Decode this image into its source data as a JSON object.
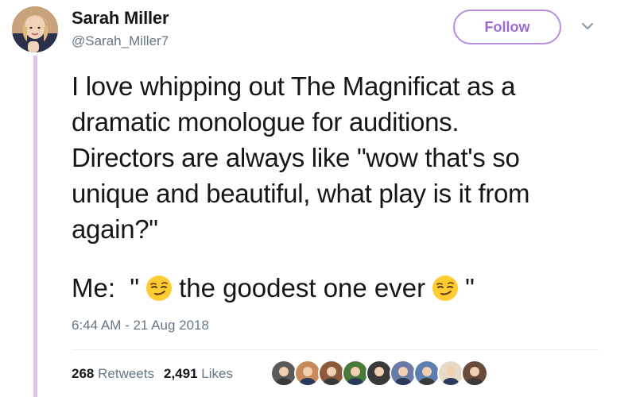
{
  "author": {
    "name": "Sarah Miller",
    "handle": "@Sarah_Miller7",
    "avatar_icon": "user-avatar-photo"
  },
  "follow": {
    "label": "Follow",
    "color": "#9d6ad3",
    "border_color": "#b68ee0"
  },
  "menu": {
    "icon": "chevron-down-icon"
  },
  "tweet": {
    "lines": [
      "I love whipping out The Magnificat as a",
      "dramatic monologue for auditions.",
      "Directors are always like \"wow that's so",
      "unique and beautiful, what play is it from",
      "again?\""
    ],
    "reply_prefix": "Me:  \"",
    "reply_middle": "the goodest one ever",
    "reply_suffix": "\"",
    "emoji": "smirking-face-emoji"
  },
  "timestamp": "6:44 AM - 21 Aug 2018",
  "stats": {
    "retweets_count": "268",
    "retweets_label": "Retweets",
    "likes_count": "2,491",
    "likes_label": "Likes"
  },
  "likers": [
    {
      "icon": "liker-avatar-1",
      "color": "#5a5a5a"
    },
    {
      "icon": "liker-avatar-2",
      "color": "#c98a5a"
    },
    {
      "icon": "liker-avatar-3",
      "color": "#8b5a3c"
    },
    {
      "icon": "liker-avatar-4",
      "color": "#4a7a3a"
    },
    {
      "icon": "liker-avatar-5",
      "color": "#3a3a3a"
    },
    {
      "icon": "liker-avatar-6",
      "color": "#6b7ba8"
    },
    {
      "icon": "liker-avatar-7",
      "color": "#5d7fb0"
    },
    {
      "icon": "liker-avatar-8",
      "color": "#e8d8c8"
    },
    {
      "icon": "liker-avatar-9",
      "color": "#6a4a3a"
    }
  ],
  "colors": {
    "thread_line": "#d9c7f0",
    "muted_text": "#657786",
    "main_text": "#14171a"
  }
}
